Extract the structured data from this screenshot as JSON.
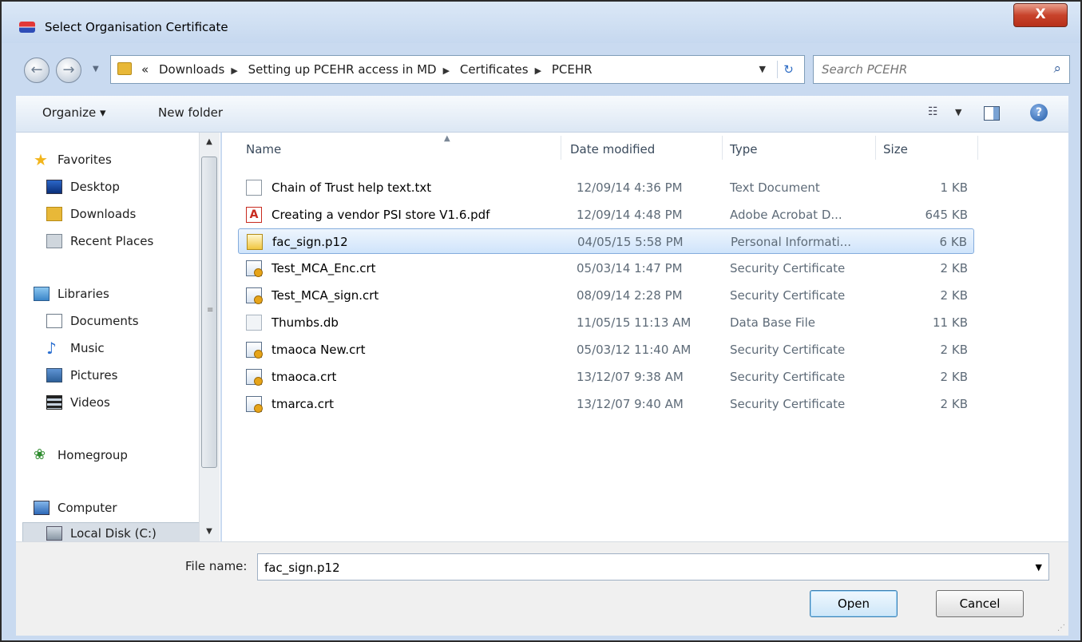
{
  "window": {
    "title": "Select Organisation Certificate",
    "close_label": "X"
  },
  "address": {
    "prefix": "«",
    "crumbs": [
      "Downloads",
      "Setting up PCEHR access in MD",
      "Certificates",
      "PCEHR"
    ]
  },
  "search": {
    "placeholder": "Search PCEHR"
  },
  "toolbar": {
    "organize_label": "Organize ▾",
    "new_folder_label": "New folder"
  },
  "nav_pane": {
    "items": [
      {
        "label": "Favorites",
        "icon": "star-icon"
      },
      {
        "label": "Desktop",
        "icon": "desktop-icon"
      },
      {
        "label": "Downloads",
        "icon": "downloads-folder-icon"
      },
      {
        "label": "Recent Places",
        "icon": "recent-places-icon"
      },
      {
        "label": "Libraries",
        "icon": "libraries-icon"
      },
      {
        "label": "Documents",
        "icon": "documents-icon"
      },
      {
        "label": "Music",
        "icon": "music-icon"
      },
      {
        "label": "Pictures",
        "icon": "pictures-icon"
      },
      {
        "label": "Videos",
        "icon": "videos-icon"
      },
      {
        "label": "Homegroup",
        "icon": "homegroup-icon"
      },
      {
        "label": "Computer",
        "icon": "computer-icon"
      },
      {
        "label": "Local Disk (C:)",
        "icon": "local-disk-icon"
      }
    ]
  },
  "file_list": {
    "columns": [
      "Name",
      "Date modified",
      "Type",
      "Size"
    ],
    "rows": [
      {
        "name": "Chain of Trust help text.txt",
        "date": "12/09/14 4:36 PM",
        "type": "Text Document",
        "size": "1 KB",
        "icon": "text-file-icon"
      },
      {
        "name": "Creating a vendor PSI store V1.6.pdf",
        "date": "12/09/14 4:48 PM",
        "type": "Adobe Acrobat D...",
        "size": "645 KB",
        "icon": "pdf-file-icon"
      },
      {
        "name": "fac_sign.p12",
        "date": "04/05/15 5:58 PM",
        "type": "Personal Informati...",
        "size": "6 KB",
        "icon": "personal-information-exchange-icon",
        "selected": true
      },
      {
        "name": "Test_MCA_Enc.crt",
        "date": "05/03/14 1:47 PM",
        "type": "Security Certificate",
        "size": "2 KB",
        "icon": "certificate-icon"
      },
      {
        "name": "Test_MCA_sign.crt",
        "date": "08/09/14 2:28 PM",
        "type": "Security Certificate",
        "size": "2 KB",
        "icon": "certificate-icon"
      },
      {
        "name": "Thumbs.db",
        "date": "11/05/15 11:13 AM",
        "type": "Data Base File",
        "size": "11 KB",
        "icon": "database-file-icon"
      },
      {
        "name": "tmaoca New.crt",
        "date": "05/03/12 11:40 AM",
        "type": "Security Certificate",
        "size": "2 KB",
        "icon": "certificate-icon"
      },
      {
        "name": "tmaoca.crt",
        "date": "13/12/07 9:38 AM",
        "type": "Security Certificate",
        "size": "2 KB",
        "icon": "certificate-icon"
      },
      {
        "name": "tmarca.crt",
        "date": "13/12/07 9:40 AM",
        "type": "Security Certificate",
        "size": "2 KB",
        "icon": "certificate-icon"
      }
    ]
  },
  "footer": {
    "file_name_label": "File name:",
    "file_name_value": "fac_sign.p12",
    "open_label": "Open",
    "cancel_label": "Cancel"
  },
  "colors": {
    "window_frame": "#c9daf0",
    "selection": "#cfe4fb",
    "close_button": "#c8432b"
  }
}
